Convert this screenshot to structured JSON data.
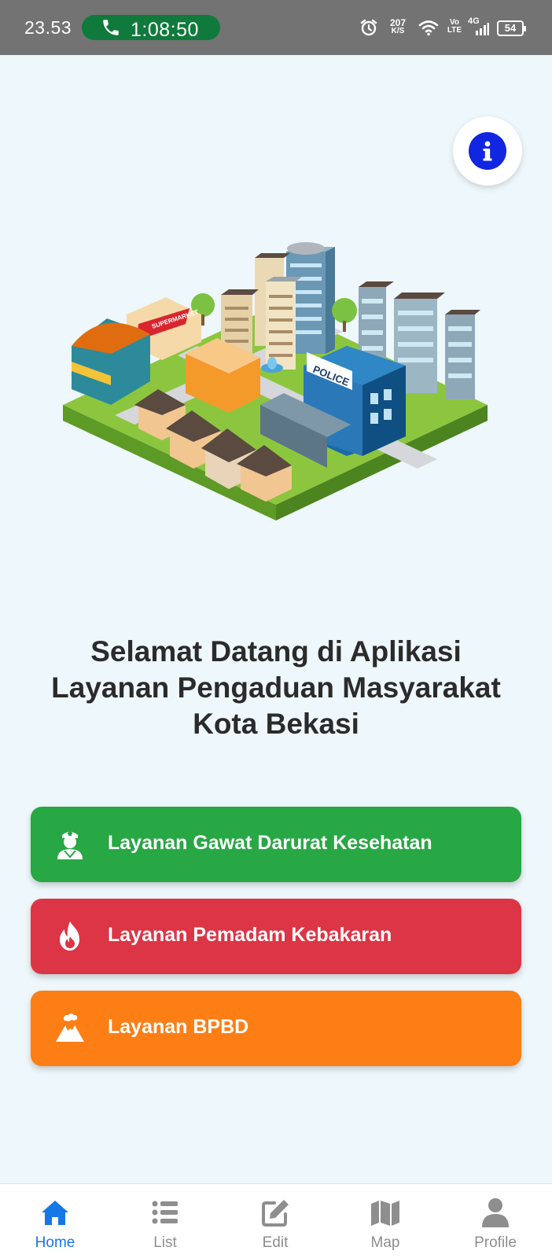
{
  "status_bar": {
    "time": "23.53",
    "call_timer": "1:08:50",
    "net_speed_value": "207",
    "net_speed_unit": "K/S",
    "volte_top": "Vo",
    "volte_bottom": "LTE",
    "network": "4G",
    "battery": "54"
  },
  "welcome": {
    "line1": "Selamat Datang di Aplikasi",
    "line2": "Layanan Pengaduan Masyarakat",
    "line3": "Kota Bekasi"
  },
  "illustration": {
    "supermarket_sign": "SUPERMARKET",
    "police_sign": "POLICE"
  },
  "services": [
    {
      "label": "Layanan Gawat Darurat Kesehatan",
      "color": "#28a745",
      "icon": "doctor-icon"
    },
    {
      "label": "Layanan Pemadam Kebakaran",
      "color": "#dc3545",
      "icon": "fire-icon"
    },
    {
      "label": "Layanan BPBD",
      "color": "#fd7e14",
      "icon": "volcano-icon"
    }
  ],
  "bottom_nav": {
    "active": "Home",
    "items": [
      {
        "label": "Home",
        "icon": "home-icon"
      },
      {
        "label": "List",
        "icon": "list-icon"
      },
      {
        "label": "Edit",
        "icon": "edit-icon"
      },
      {
        "label": "Map",
        "icon": "map-icon"
      },
      {
        "label": "Profile",
        "icon": "profile-icon"
      }
    ]
  },
  "colors": {
    "background": "#eef7fb",
    "status_bar": "#737373",
    "call_pill": "#0f7a3c",
    "info_button": "#1126e0",
    "nav_active": "#1677e6",
    "nav_inactive": "#8e8e8e"
  }
}
